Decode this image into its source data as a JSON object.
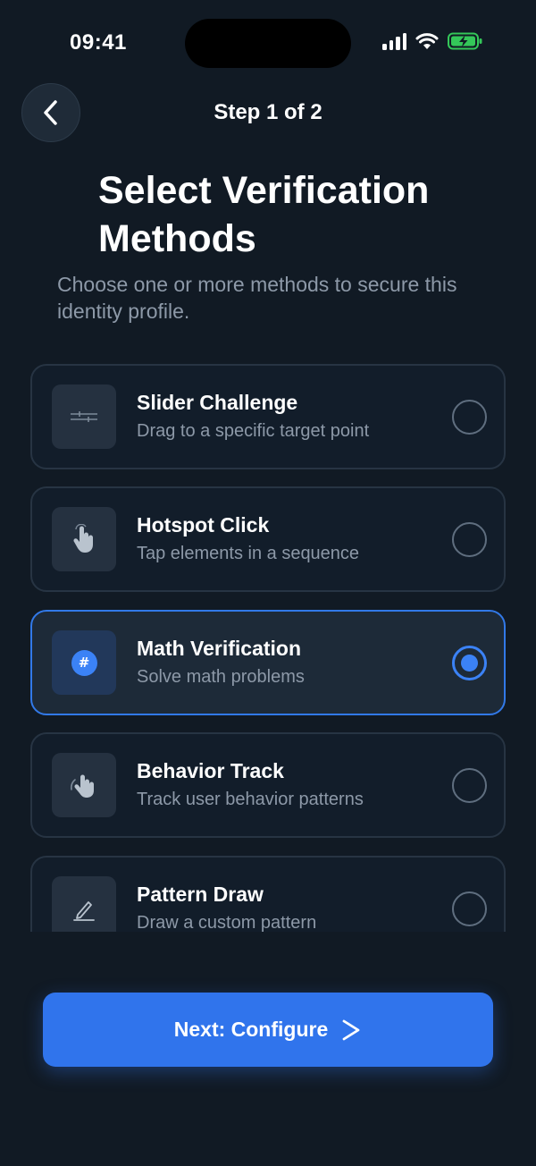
{
  "status_bar": {
    "time": "09:41",
    "icons": [
      "cellular-signal-icon",
      "wifi-icon",
      "battery-charging-icon"
    ],
    "battery_color": "#34c759"
  },
  "header": {
    "back_icon": "chevron-left-icon",
    "step": "Step 1 of 2"
  },
  "title": "Select Verification Methods",
  "subtitle": "Choose one or more methods to secure this identity profile.",
  "methods": [
    {
      "icon": "slider-icon",
      "title": "Slider Challenge",
      "description": "Drag to a specific target point",
      "selected": false
    },
    {
      "icon": "tap-hand-icon",
      "title": "Hotspot Click",
      "description": "Tap elements in a sequence",
      "selected": false
    },
    {
      "icon": "hash-icon",
      "title": "Math Verification",
      "description": "Solve math problems",
      "selected": true
    },
    {
      "icon": "swipe-hand-icon",
      "title": "Behavior Track",
      "description": "Track user behavior patterns",
      "selected": false
    },
    {
      "icon": "pen-draw-icon",
      "title": "Pattern Draw",
      "description": "Draw a custom pattern",
      "selected": false
    }
  ],
  "cta": {
    "label": "Next: Configure",
    "icon": "chevron-right-icon"
  },
  "colors": {
    "background": "#111a24",
    "accent": "#3b82f6",
    "button": "#3074ec",
    "muted_text": "#8d99a8"
  }
}
